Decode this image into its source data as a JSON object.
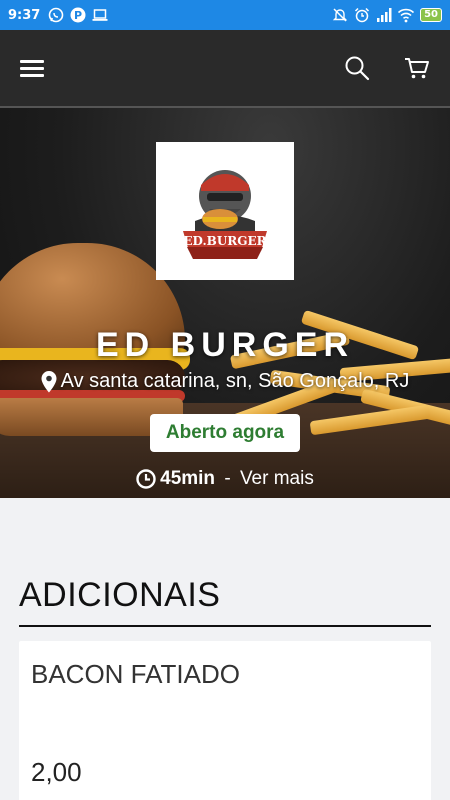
{
  "status_bar": {
    "time": "9:37",
    "left_icons": [
      "whatsapp-icon",
      "parking-app-icon",
      "laptop-icon"
    ],
    "right_icons": [
      "mute-icon",
      "alarm-icon",
      "signal-icon",
      "wifi-icon"
    ],
    "battery": "50",
    "color": "#1e88e5"
  },
  "app_bar": {
    "icons": [
      "menu-icon",
      "search-icon",
      "cart-icon"
    ],
    "background": "#2a2a2a"
  },
  "store": {
    "name": "ED BURGER",
    "address": "Av santa catarina, sn, São Gonçalo, RJ",
    "status": "Aberto agora",
    "status_color": "#2e7d32",
    "delivery_time": "45min",
    "delivery_separator": " - ",
    "more_label": "Ver mais",
    "logo_icon": "ed-burger-logo"
  },
  "section": {
    "title": "ADICIONAIS"
  },
  "products": [
    {
      "name": "BACON FATIADO",
      "price": "2,00"
    }
  ]
}
